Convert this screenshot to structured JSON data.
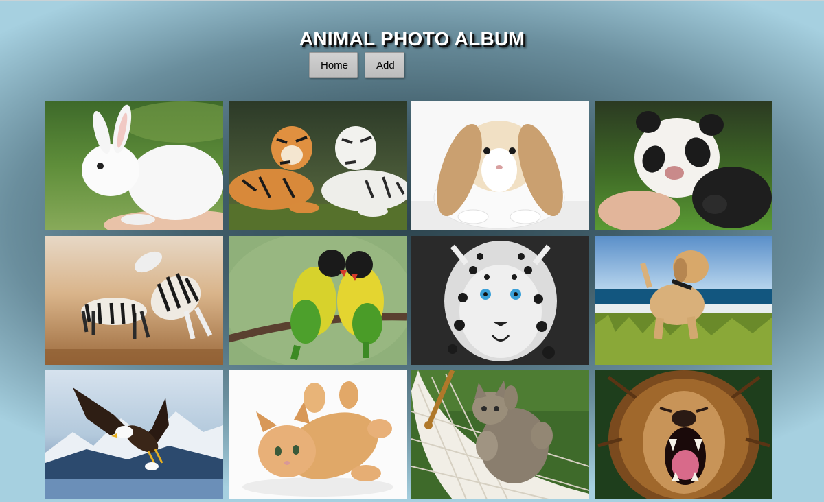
{
  "header": {
    "title": "ANIMAL PHOTO ALBUM"
  },
  "nav": {
    "home_label": "Home",
    "add_label": "Add"
  },
  "album": {
    "photos": [
      {
        "subject": "white rabbit on hand",
        "icon": "rabbit-photo"
      },
      {
        "subject": "orange tiger and white tiger",
        "icon": "tigers-photo"
      },
      {
        "subject": "lop-eared bunny",
        "icon": "bunny-photo"
      },
      {
        "subject": "baby panda in hand",
        "icon": "panda-photo"
      },
      {
        "subject": "zebras fighting",
        "icon": "zebras-photo"
      },
      {
        "subject": "lovebirds on branch",
        "icon": "lovebirds-photo"
      },
      {
        "subject": "snow leopard black and white",
        "icon": "snow-leopard-photo"
      },
      {
        "subject": "golden retriever puppy at beach",
        "icon": "puppy-photo"
      },
      {
        "subject": "bald eagle in flight",
        "icon": "eagle-photo"
      },
      {
        "subject": "orange kitten playing",
        "icon": "kitten-photo"
      },
      {
        "subject": "kitten in hammock",
        "icon": "hammock-kitten-photo"
      },
      {
        "subject": "roaring lion",
        "icon": "lion-photo"
      }
    ]
  },
  "colors": {
    "background_center": "#2e4650",
    "background_edge": "#a6d0e0",
    "button_bg": "#c8c8c8",
    "title_text": "#ffffff"
  }
}
